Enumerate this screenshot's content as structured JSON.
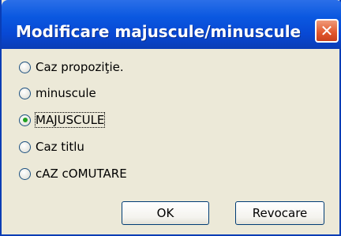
{
  "dialog": {
    "title": "Modificare majuscule/minuscule",
    "close_symbol": "✕"
  },
  "options": [
    {
      "label": "Caz propoziţie.",
      "checked": false
    },
    {
      "label": "minuscule",
      "checked": false
    },
    {
      "label": "MAJUSCULE",
      "checked": true
    },
    {
      "label": "Caz titlu",
      "checked": false
    },
    {
      "label": "cAZ cOMUTARE",
      "checked": false
    }
  ],
  "buttons": {
    "ok": "OK",
    "cancel": "Revocare"
  },
  "colors": {
    "titlebar": "#0a58e0",
    "dialog_bg": "#ece9d8",
    "close_button": "#e2572c",
    "radio_selected": "#21a121"
  },
  "icons": {
    "close": "close-icon",
    "radio": "radio-icon"
  }
}
